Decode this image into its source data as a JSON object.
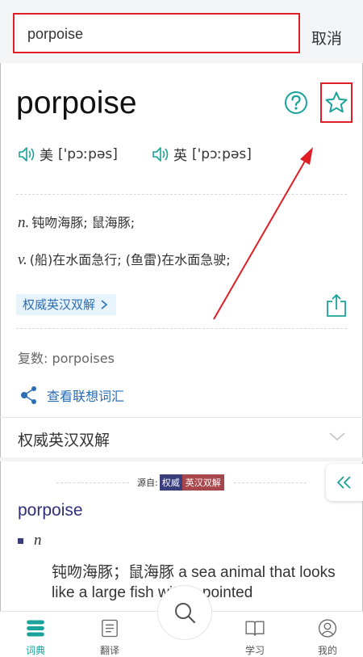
{
  "search": {
    "value": "porpoise",
    "cancel_label": "取消"
  },
  "entry": {
    "word": "porpoise",
    "pron": [
      {
        "region": "美",
        "ipa": "['pɔːpəs]"
      },
      {
        "region": "英",
        "ipa": "['pɔːpəs]"
      }
    ],
    "definitions": [
      {
        "pos": "n.",
        "text": "钝吻海豚; 鼠海豚;"
      },
      {
        "pos": "v.",
        "text": "(船)在水面急行; (鱼雷)在水面急驶;"
      }
    ],
    "auth_chip": "权威英汉双解",
    "plural": "复数: porpoises",
    "related": "查看联想词汇"
  },
  "section": {
    "title": "权威英汉双解",
    "source_label": "源自:",
    "source_a": "权威",
    "source_b": "英汉双解"
  },
  "detail": {
    "word": "porpoise",
    "pos": "n",
    "definition": "钝吻海豚；鼠海豚 a sea animal that looks like a large fish with a pointed"
  },
  "tabbar": {
    "tabs": [
      {
        "label": "词典",
        "active": true
      },
      {
        "label": "翻译"
      },
      {
        "label": "学习"
      },
      {
        "label": "我的"
      }
    ]
  },
  "colors": {
    "accent": "#1aa39a",
    "link": "#2a6db5",
    "highlight": "#e01e25"
  }
}
